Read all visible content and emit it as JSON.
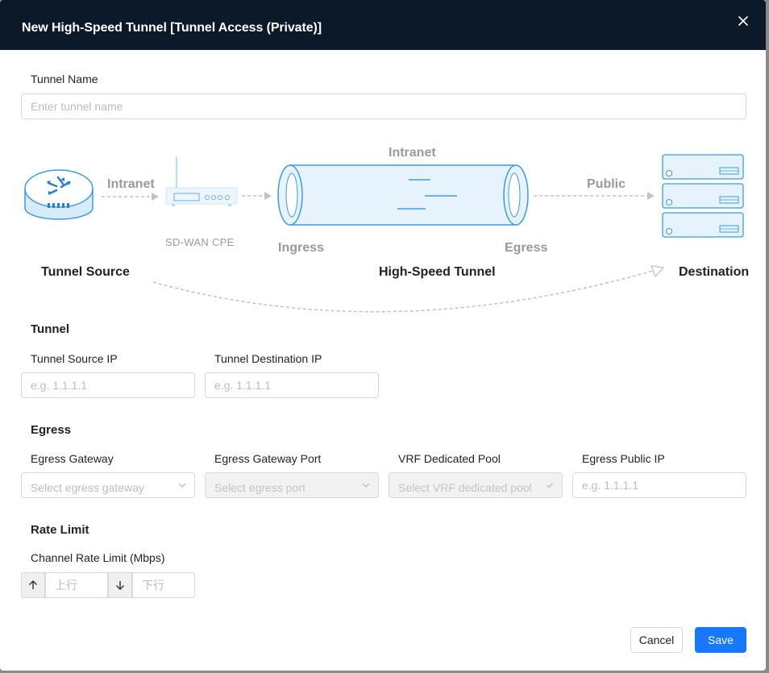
{
  "dialog": {
    "title": "New High-Speed Tunnel [Tunnel Access (Private)]",
    "close_glyph": "✕"
  },
  "tunnel_name": {
    "label": "Tunnel Name",
    "placeholder": "Enter tunnel name",
    "value": ""
  },
  "diagram": {
    "intranet_left": "Intranet",
    "intranet_top": "Intranet",
    "public": "Public",
    "cpe_label": "SD-WAN CPE",
    "ingress": "Ingress",
    "egress": "Egress",
    "tunnel_source": "Tunnel Source",
    "high_speed_tunnel": "High-Speed Tunnel",
    "destination": "Destination",
    "colors": {
      "accent": "#3a9ce8",
      "tunnel_fill": "#e6f3fd",
      "muted_text": "#9a9a9a"
    },
    "icons": [
      "router-icon",
      "sd-wan-cpe-icon",
      "tunnel-pipe-icon",
      "server-stack-icon"
    ]
  },
  "tunnel_section": {
    "title": "Tunnel",
    "source_ip": {
      "label": "Tunnel Source IP",
      "placeholder": "e.g. 1.1.1.1",
      "value": ""
    },
    "destination_ip": {
      "label": "Tunnel Destination IP",
      "placeholder": "e.g. 1.1.1.1",
      "value": ""
    }
  },
  "egress_section": {
    "title": "Egress",
    "gateway": {
      "label": "Egress Gateway",
      "placeholder": "Select egress gateway"
    },
    "gateway_port": {
      "label": "Egress Gateway Port",
      "placeholder": "Select egress port"
    },
    "vrf_pool": {
      "label": "VRF Dedicated Pool",
      "placeholder": "Select VRF dedicated pool"
    },
    "public_ip": {
      "label": "Egress Public IP",
      "placeholder": "e.g. 1.1.1.1",
      "value": ""
    }
  },
  "rate_limit_section": {
    "title": "Rate Limit",
    "channel_label": "Channel Rate Limit (Mbps)",
    "up_placeholder": "上行",
    "down_placeholder": "下行",
    "up_icon": "arrow-up-icon",
    "down_icon": "arrow-down-icon"
  },
  "footer": {
    "cancel_label": "Cancel",
    "save_label": "Save",
    "primary_color": "#1677ff"
  }
}
